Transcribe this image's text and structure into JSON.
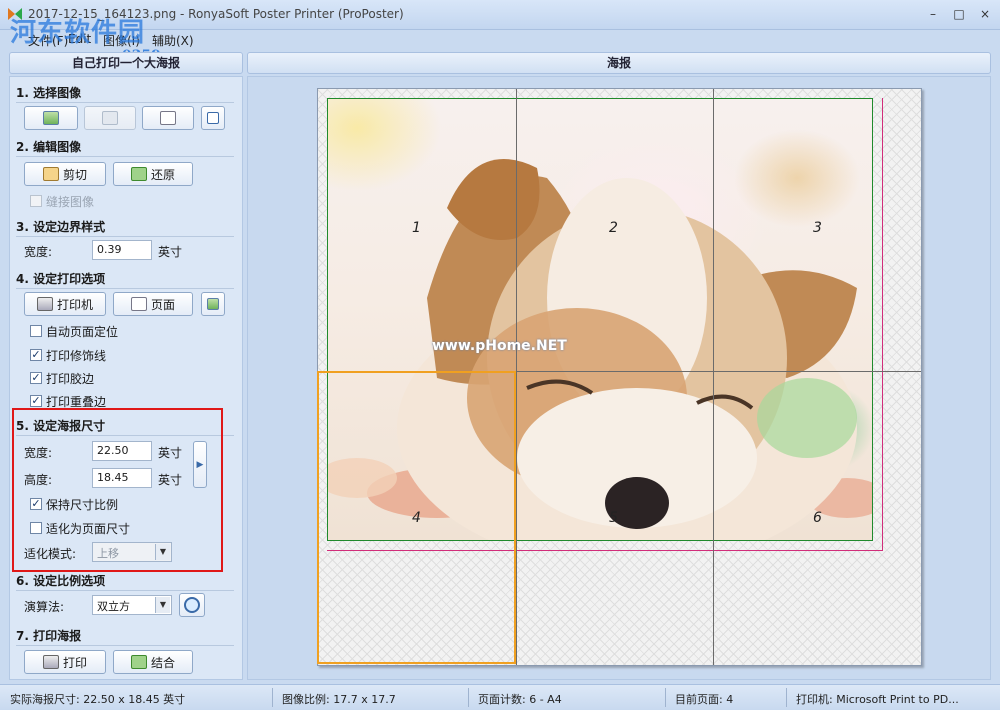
{
  "window": {
    "title": "2017-12-15_164123.png - RonyaSoft Poster Printer (ProPoster)",
    "controls": [
      "–",
      "□",
      "×"
    ]
  },
  "menu": [
    "文件(F)",
    "Edit",
    "图像(I)",
    "辅助(X)"
  ],
  "watermark": {
    "logo": "河东软件园",
    "url": "www.pc0359.cn",
    "center": "www.pHome.NET"
  },
  "left_header": "自己打印一个大海报",
  "right_header": "海报",
  "sections": {
    "s1": "1. 选择图像",
    "s2": "2. 编辑图像",
    "s3": "3. 设定边界样式",
    "s4": "4. 设定打印选项",
    "s5": "5. 设定海报尺寸",
    "s6": "6. 设定比例选项",
    "s7": "7. 打印海报"
  },
  "edit": {
    "crop": "剪切",
    "restore": "还原",
    "stitch": "缝接图像"
  },
  "border": {
    "width_label": "宽度:",
    "width_value": "0.39",
    "unit": "英寸"
  },
  "print_options": {
    "printer_btn": "打印机",
    "page_btn": "页面",
    "auto_page": "自动页面定位",
    "print_trim": "打印修饰线",
    "print_glue": "打印胶边",
    "print_overlap": "打印重叠边"
  },
  "poster_size": {
    "width_label": "宽度:",
    "width_value": "22.50",
    "height_label": "高度:",
    "height_value": "18.45",
    "unit": "英寸",
    "keep_ratio": "保持尺寸比例",
    "fit_page": "适化为页面尺寸",
    "fit_mode_label": "适化模式:",
    "fit_mode_value": "上移"
  },
  "scale": {
    "algo_label": "演算法:",
    "algo_value": "双立方"
  },
  "print": {
    "print_btn": "打印",
    "combine_btn": "结合"
  },
  "tiles": [
    "1",
    "2",
    "3",
    "4",
    "5",
    "6"
  ],
  "status": {
    "actual_size": "实际海报尺寸: 22.50 x 18.45 英寸",
    "ratio": "图像比例: 17.7 x 17.7",
    "page_count": "页面计数: 6 - A4",
    "current_page": "目前页面: 4",
    "printer": "打印机: Microsoft Print to PD..."
  }
}
